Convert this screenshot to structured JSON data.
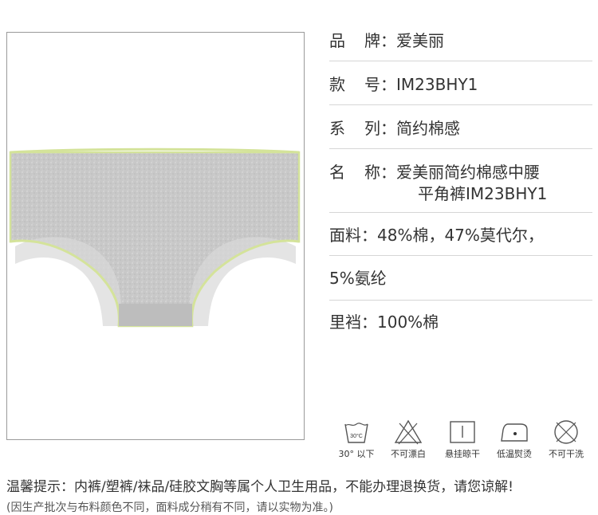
{
  "spec": {
    "brand": {
      "label_a": "品",
      "label_b": "牌",
      "sep": "：",
      "value": "爱美丽"
    },
    "style_no": {
      "label_a": "款",
      "label_b": "号",
      "sep": "：",
      "value": "IM23BHY1"
    },
    "series": {
      "label_a": "系",
      "label_b": "列",
      "sep": "：",
      "value": "简约棉感"
    },
    "name": {
      "label_a": "名",
      "label_b": "称",
      "sep": "：",
      "value_line1": "爱美丽简约棉感中腰",
      "value_line2": "平角裤IM23BHY1"
    },
    "fabric": {
      "label": "面料",
      "sep": "：",
      "value_line1": "48%棉，47%莫代尔，",
      "value_line2": "5%氨纶"
    },
    "lining": {
      "label": "里裆",
      "sep": "：",
      "value": "100%棉"
    }
  },
  "care_icons": [
    {
      "icon": "wash-30-icon",
      "inner_text": "30°C",
      "caption": "30° 以下"
    },
    {
      "icon": "no-bleach-icon",
      "caption": "不可漂白"
    },
    {
      "icon": "hang-dry-icon",
      "caption": "悬挂晾干"
    },
    {
      "icon": "low-iron-icon",
      "caption": "低温熨烫"
    },
    {
      "icon": "no-dry-clean-icon",
      "caption": "不可干洗"
    }
  ],
  "notice": "温馨提示：内裤/塑裤/袜品/硅胶文胸等属个人卫生用品，不能办理退换货，请您谅解!",
  "sub_notice": "(因生产批次与布料颜色不同，面料成分稍有不同，请以实物为准。)",
  "colors": {
    "fabric_gray": "#c9c9c9",
    "trim_lime": "#d4e39a",
    "text": "#333333",
    "rule": "#d6d6d6"
  }
}
